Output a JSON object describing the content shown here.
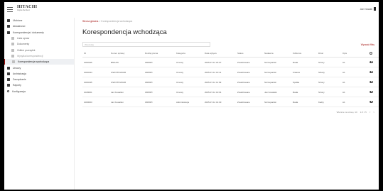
{
  "header": {
    "brand": "HITACHI",
    "tagline": "Inspire the Next",
    "user_name": "Jan Nowak"
  },
  "sidebar": {
    "items": [
      {
        "label": "Ulubione",
        "level": 0,
        "icon": "grid-icon",
        "state": "normal"
      },
      {
        "label": "Aktualności",
        "level": 0,
        "icon": "news-icon",
        "state": "faded"
      },
      {
        "label": "Korespondencja i dokumenty",
        "level": 0,
        "icon": "folder-icon",
        "state": "normal"
      },
      {
        "label": "Lista spraw",
        "level": 1,
        "icon": "list-icon",
        "state": "normal"
      },
      {
        "label": "Dokumenty",
        "level": 1,
        "icon": "document-icon",
        "state": "normal"
      },
      {
        "label": "Odbiór przesyłek",
        "level": 1,
        "icon": "inbox-icon",
        "state": "normal"
      },
      {
        "label": "Wysyłka korespondencji",
        "level": 1,
        "icon": "send-icon",
        "state": "faded"
      },
      {
        "label": "Korespondencja wychodząca",
        "level": 1,
        "icon": "outbox-icon",
        "state": "active"
      },
      {
        "label": "Umowy",
        "level": 0,
        "icon": "contract-icon",
        "state": "normal"
      },
      {
        "label": "Archiwizacja",
        "level": 0,
        "icon": "archive-icon",
        "state": "normal"
      },
      {
        "label": "Zarządzanie",
        "level": 0,
        "icon": "manage-icon",
        "state": "normal"
      },
      {
        "label": "Raporty",
        "level": 0,
        "icon": "chart-icon",
        "state": "normal"
      },
      {
        "label": "Konfiguracja",
        "level": 0,
        "icon": "gear-icon",
        "state": "normal"
      }
    ]
  },
  "breadcrumb": {
    "home": "Strona główna",
    "separator": ">",
    "current": "Korespondencja wchodząca"
  },
  "page": {
    "title": "Korespondencja wchodząca",
    "search_placeholder": "Wyszukaj",
    "reset_label": "Wyczyść filtry"
  },
  "table": {
    "headers": [
      "ID",
      "Numer sprawy",
      "Rodzaj pisma",
      "Kategoria",
      "Data wpływu",
      "Status",
      "Nadawca",
      "Odbiorca",
      "Dział",
      "Opis",
      ""
    ],
    "rows": [
      [
        "1000345",
        "BN/1/26",
        "IZM/9PI",
        "Umowy",
        "2025-07-11 15:07",
        "Zrealizowane",
        "Szczepański",
        "Rada",
        "Strony",
        "A1"
      ],
      [
        "1000234",
        "USZ/7/PO/2026",
        "IZM/9PI",
        "Umowy",
        "2025-07-11 10:11",
        "Zrealizowane",
        "Szczepański",
        "Kraków",
        "Szkoły",
        "A1"
      ],
      [
        "1000235",
        "USZ/7/PO/2026",
        "IZM/9PI",
        "Umowy",
        "2025-07-11 11:09",
        "Zrealizowane",
        "Szczepański",
        "Spółka",
        "Strony",
        "A1"
      ],
      [
        "1029001",
        "Jan Kowalski",
        "IZM/9PI",
        "Umowy",
        "2025-07-11 10:01",
        "Zrealizowane",
        "Jan Kowalski",
        "Rada",
        "Strony",
        "A1"
      ],
      [
        "1000003",
        "Jan Kowalski",
        "IZM/9PI",
        "Administracja",
        "2025-07-11 14:03",
        "Zrealizowane",
        "Szczepański",
        "Rada",
        "Kadry",
        "A1"
      ]
    ]
  },
  "pagination": {
    "rows_label": "Wiersze na stronę: 10",
    "range": "1-5 z 5",
    "prev": "<",
    "next": ">"
  },
  "colors": {
    "accent": "#a3120f",
    "background": "#ffffff",
    "frame": "#000000"
  }
}
